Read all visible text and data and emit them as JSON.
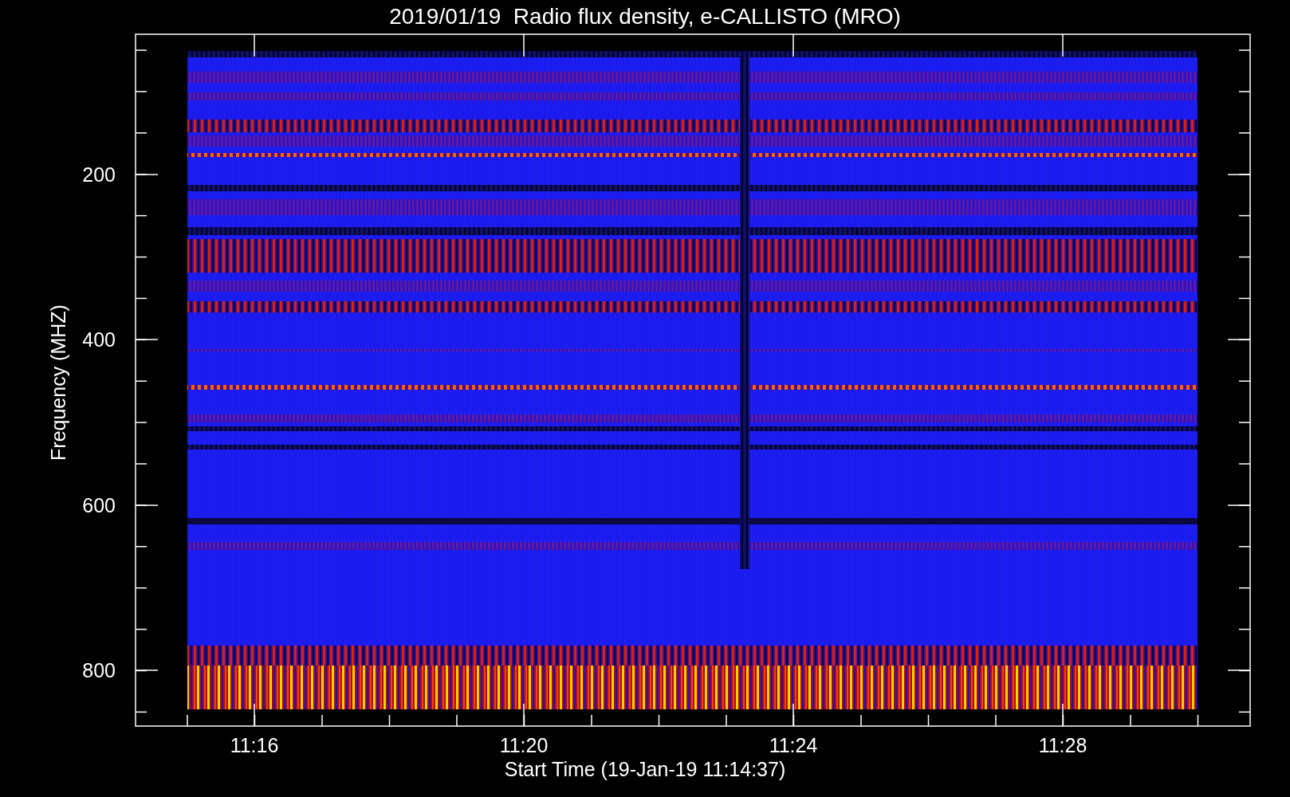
{
  "title": "2019/01/19  Radio flux density, e-CALLISTO (MRO)",
  "y_axis": {
    "label": "Frequency (MHZ)",
    "ticks": [
      "200",
      "400",
      "600",
      "800"
    ]
  },
  "x_axis": {
    "label": "Start Time (19-Jan-19 11:14:37)",
    "ticks": [
      "11:16",
      "11:20",
      "11:24",
      "11:28"
    ]
  }
}
